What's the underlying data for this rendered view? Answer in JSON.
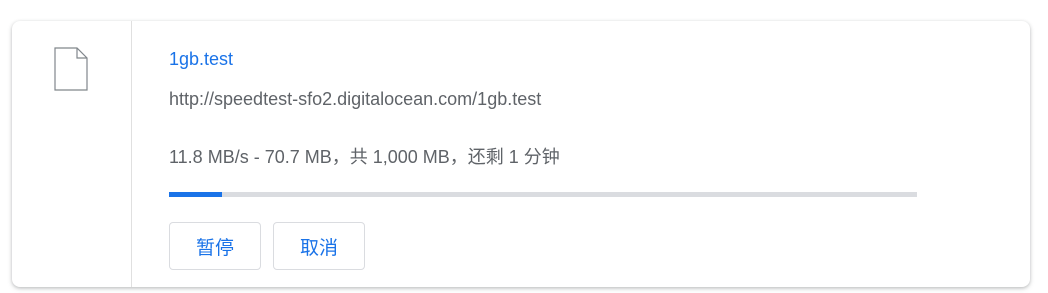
{
  "download": {
    "file_name": "1gb.test",
    "url": "http://speedtest-sfo2.digitalocean.com/1gb.test",
    "status": "11.8 MB/s - 70.7 MB，共 1,000 MB，还剩 1 分钟",
    "progress_fraction": 0.0707,
    "icon": "file-icon"
  },
  "buttons": {
    "pause_label": "暂停",
    "cancel_label": "取消"
  },
  "colors": {
    "accent": "#1a73e8",
    "secondary_text": "#5f6368",
    "track": "#dadce0"
  }
}
